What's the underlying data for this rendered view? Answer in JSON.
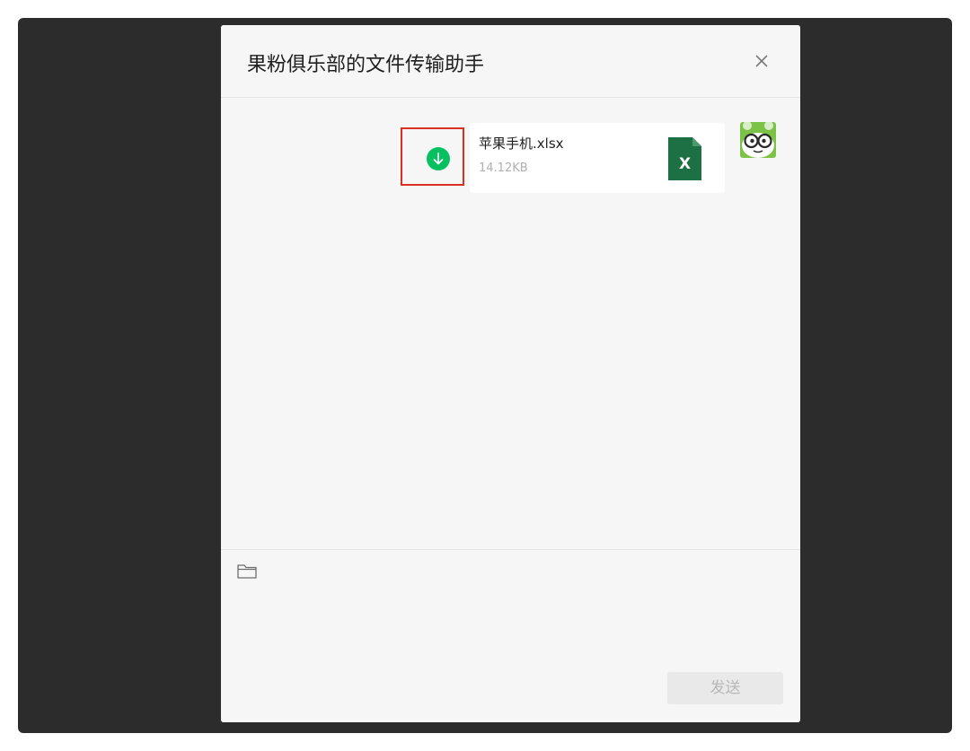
{
  "dialog": {
    "title": "果粉俱乐部的文件传输助手"
  },
  "message": {
    "file_name": "苹果手机.xlsx",
    "file_size": "14.12KB",
    "file_type_icon": "excel-file-icon",
    "file_type_letter": "X",
    "download_icon": "download-arrow-icon"
  },
  "input": {
    "send_label": "发送",
    "folder_icon": "folder-icon"
  },
  "colors": {
    "excel_green": "#1d7044",
    "download_green": "#07c160",
    "highlight_red": "#d9301f",
    "avatar_green": "#7cc246"
  }
}
